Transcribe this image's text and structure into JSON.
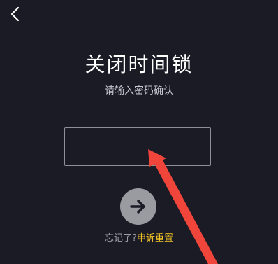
{
  "header": {
    "back_icon": "chevron-left-icon"
  },
  "main": {
    "title": "关闭时间锁",
    "subtitle": "请输入密码确认",
    "password_input": {
      "value": "",
      "placeholder": ""
    },
    "confirm_icon": "arrow-right-icon"
  },
  "footer": {
    "forgot_text": "忘记了?",
    "appeal_link": "申诉重置"
  },
  "colors": {
    "background": "#1b1b26",
    "accent": "#f5c623",
    "annotation": "#f0453a"
  }
}
